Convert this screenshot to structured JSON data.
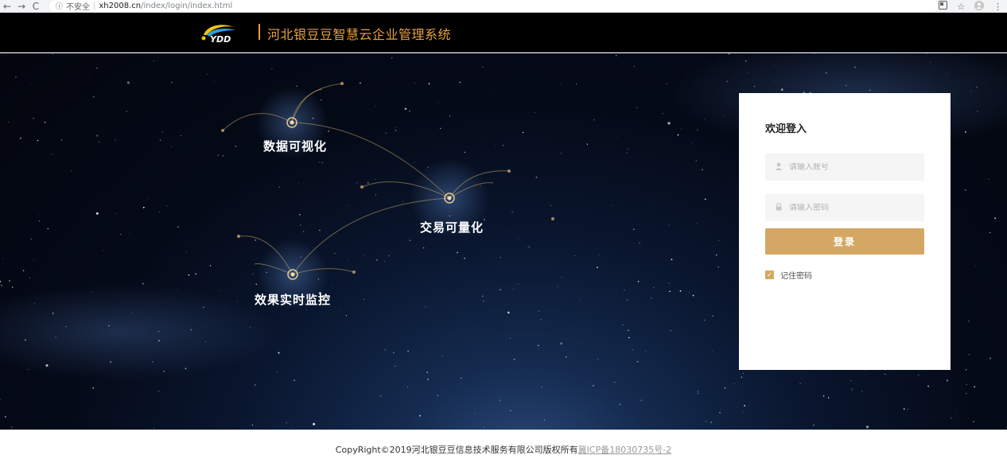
{
  "browser": {
    "back_icon": "←",
    "forward_icon": "→",
    "reload_icon": "C",
    "info_icon": "ⓘ",
    "security_label": "不安全",
    "separator": "|",
    "url_host": "xh2008.cn",
    "url_path": "/index/login/index.html"
  },
  "header": {
    "logo_text": "YDD",
    "title": "河北银豆豆智慧云企业管理系统",
    "accent_color": "#e5a13e"
  },
  "hero": {
    "nodes": [
      {
        "label": "数据可视化"
      },
      {
        "label": "交易可量化"
      },
      {
        "label": "效果实时监控"
      }
    ]
  },
  "login": {
    "title": "欢迎登入",
    "username_placeholder": "请输入账号",
    "password_placeholder": "请输入密码",
    "submit_label": "登录",
    "remember_label": "记住密码",
    "remember_checked": true,
    "button_color": "#d4a864"
  },
  "footer": {
    "copyright": "CopyRight©2019河北银豆豆信息技术服务有限公司版权所有",
    "icp_link": "冀ICP备18030735号-2"
  }
}
